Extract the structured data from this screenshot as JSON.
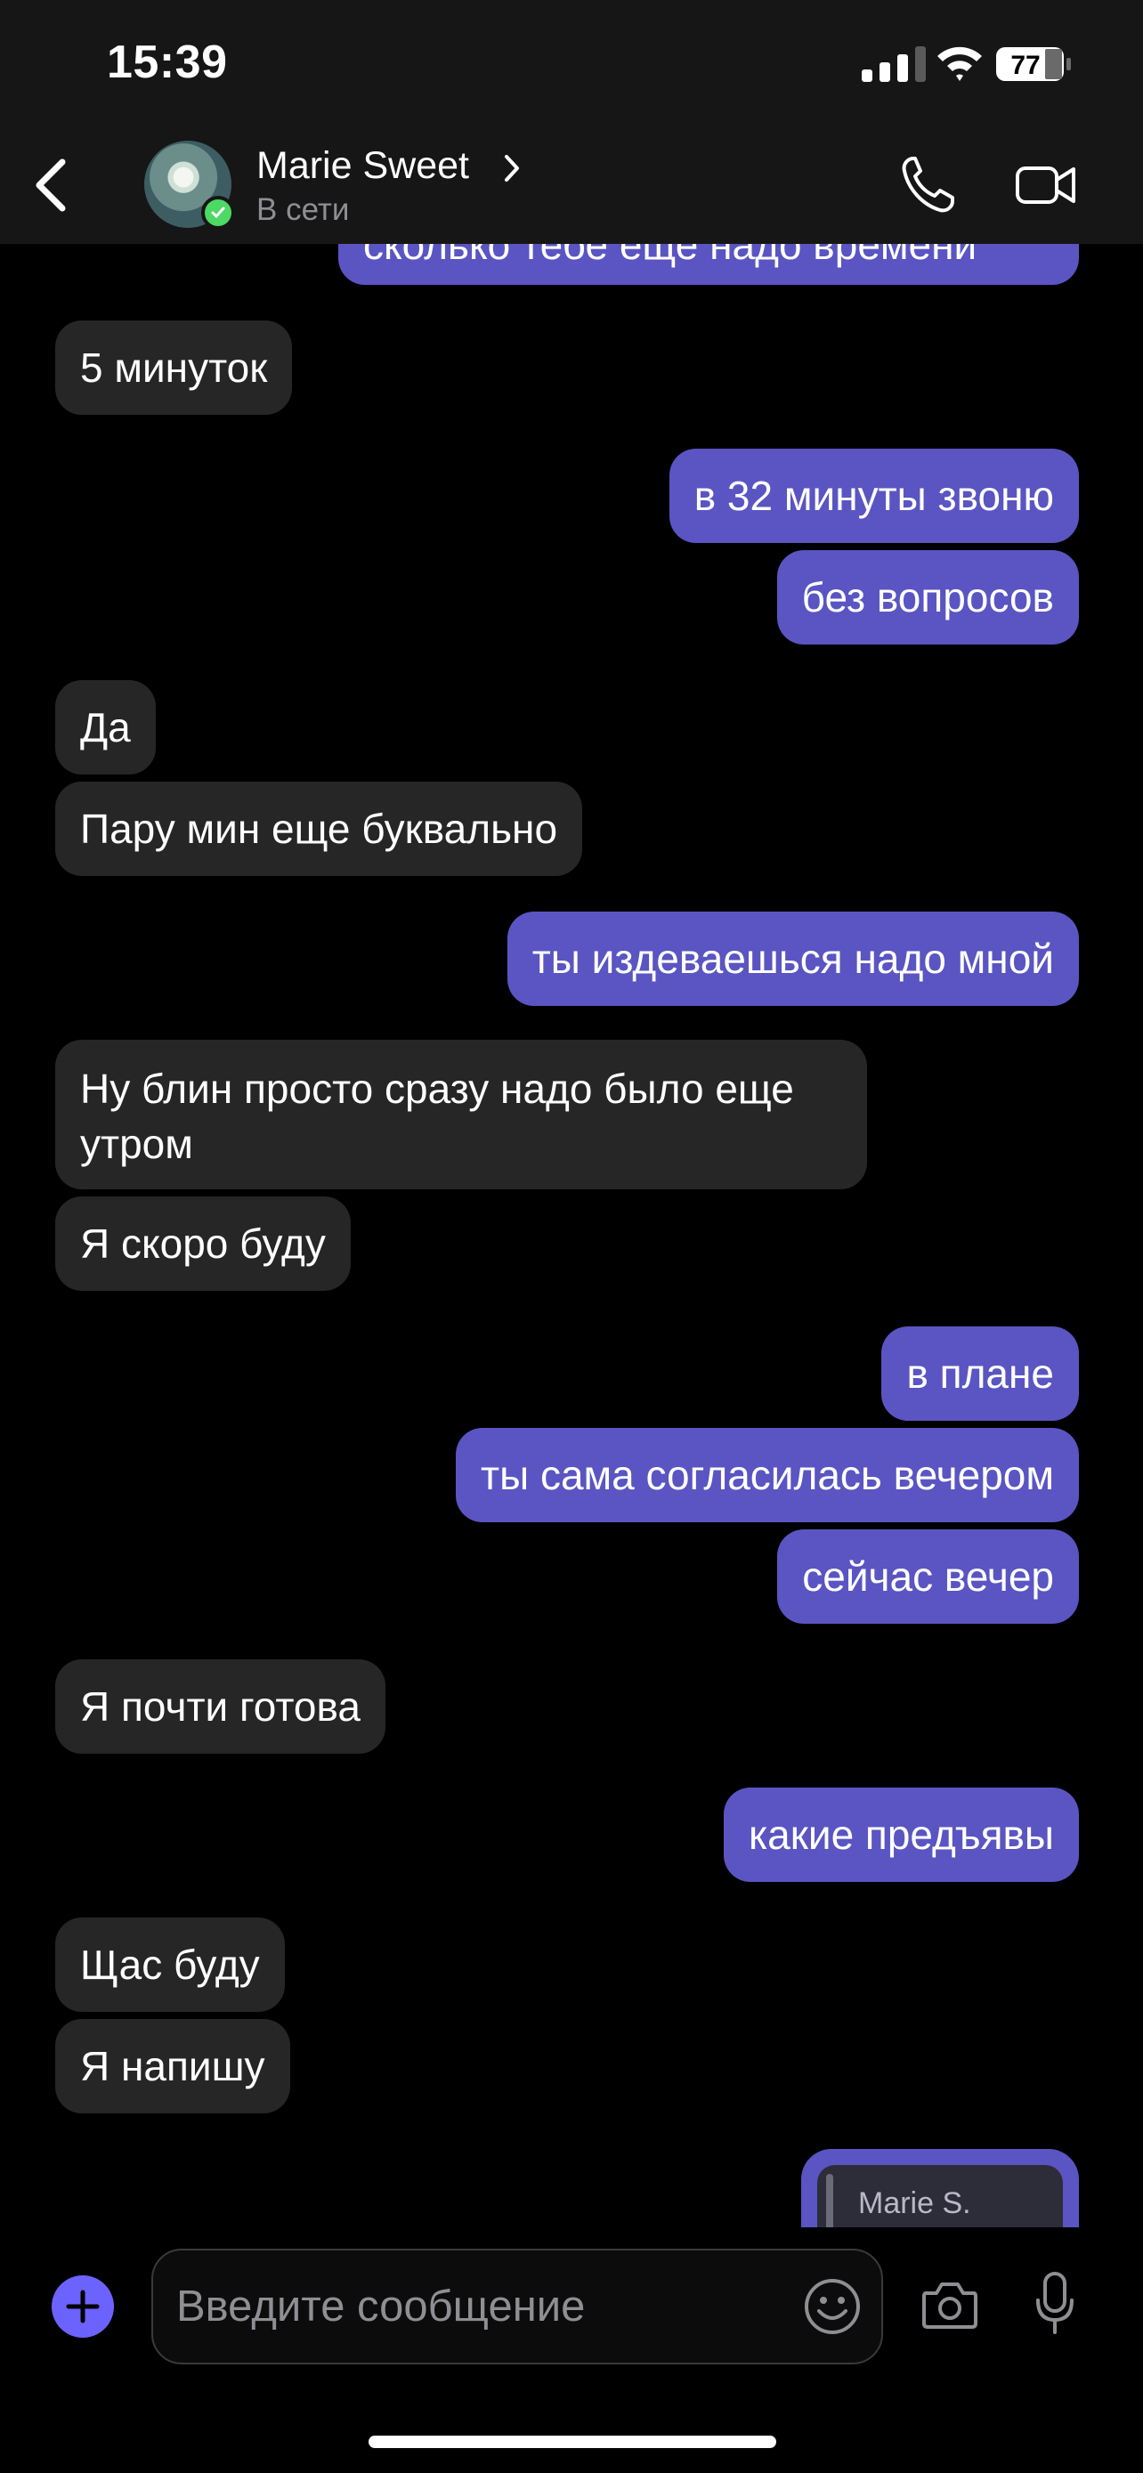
{
  "status_bar": {
    "time": "15:39",
    "battery": "77"
  },
  "header": {
    "contact_name": "Marie Sweet",
    "contact_status": "В сети"
  },
  "messages": [
    {
      "dir": "out",
      "text": "сколько тебе еще надо времени"
    },
    {
      "dir": "in",
      "text": "5 минуток"
    },
    {
      "dir": "out",
      "text": "в 32 минуты звоню"
    },
    {
      "dir": "out",
      "text": "без вопросов"
    },
    {
      "dir": "in",
      "text": "Да"
    },
    {
      "dir": "in",
      "text": "Пару мин еще буквально"
    },
    {
      "dir": "out",
      "text": "ты издеваешься надо мной"
    },
    {
      "dir": "in",
      "text": "Ну блин просто сразу надо было еще утром"
    },
    {
      "dir": "in",
      "text": "Я скоро буду"
    },
    {
      "dir": "out",
      "text": "в плане"
    },
    {
      "dir": "out",
      "text": "ты сама согласилась вечером"
    },
    {
      "dir": "out",
      "text": "сейчас вечер"
    },
    {
      "dir": "in",
      "text": "Я почти готова"
    },
    {
      "dir": "out",
      "text": "какие предъявы"
    },
    {
      "dir": "in",
      "text": "Щас буду"
    },
    {
      "dir": "in",
      "text": "Я напишу"
    }
  ],
  "quoted_reply": {
    "author": "Marie S."
  },
  "composer": {
    "placeholder": "Введите сообщение"
  },
  "colors": {
    "outgoing_bubble": "#5a55c2",
    "incoming_bubble": "#262626",
    "accent": "#6c63ff",
    "online": "#4cd964"
  }
}
